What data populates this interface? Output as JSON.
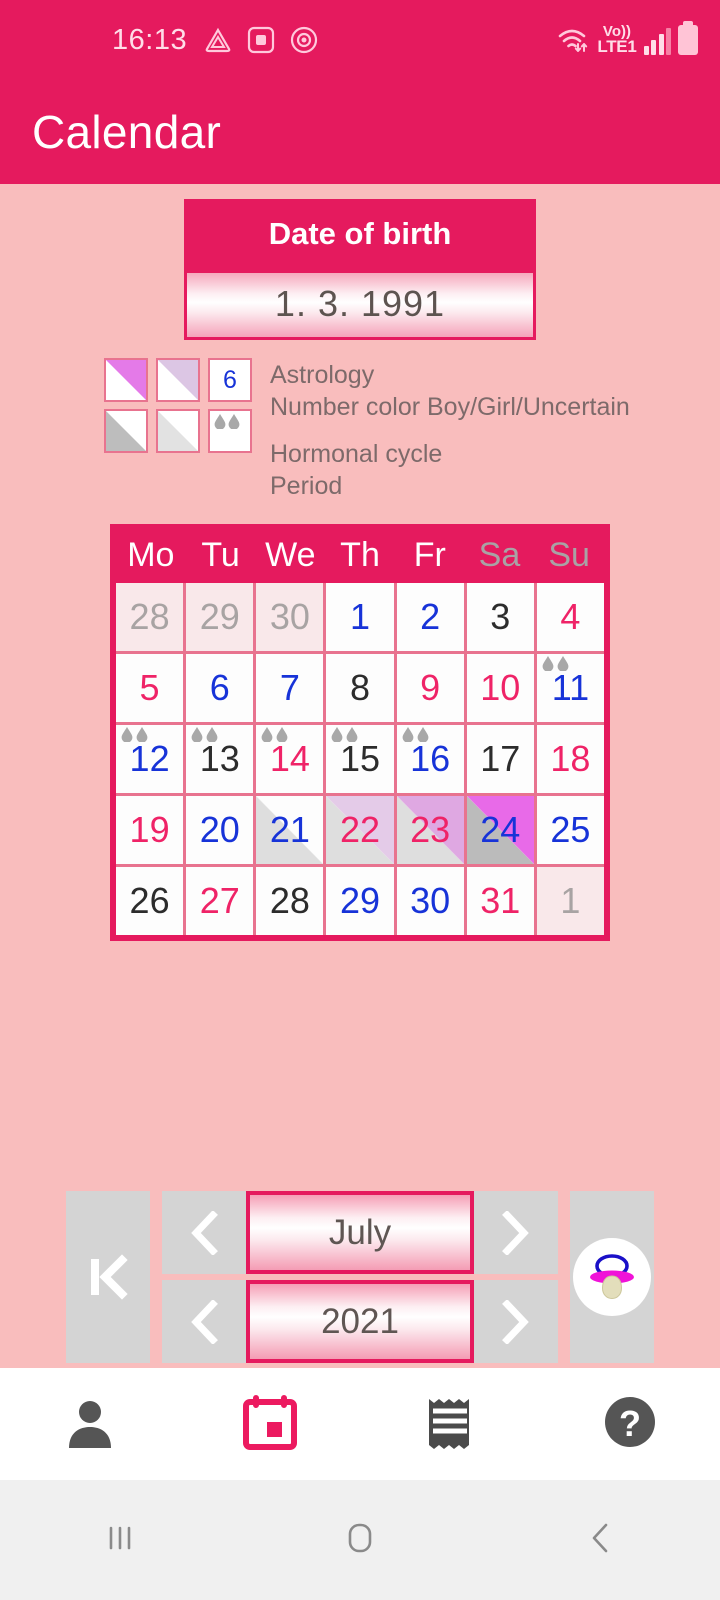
{
  "status_bar": {
    "time": "16:13",
    "network_label_top": "Vo))",
    "network_label_bottom": "LTE1",
    "icons": [
      "triangle-app-icon",
      "screenshot-icon",
      "record-icon",
      "wifi-icon",
      "signal-icon",
      "battery-icon"
    ]
  },
  "header": {
    "title": "Calendar"
  },
  "dob": {
    "label": "Date of birth",
    "value": "1. 3. 1991"
  },
  "legend": {
    "astrology_title": "Astrology",
    "astrology_sub": "Number color Boy/Girl/Uncertain",
    "hormonal_title": "Hormonal cycle",
    "period_title": "Period",
    "sample_number": "6"
  },
  "calendar": {
    "weekdays": [
      "Mo",
      "Tu",
      "We",
      "Th",
      "Fr",
      "Sa",
      "Su"
    ],
    "weekend_index": [
      5,
      6
    ],
    "month": "July",
    "year": "2021",
    "weeks": [
      [
        {
          "d": "28",
          "color": "gray",
          "outside": true
        },
        {
          "d": "29",
          "color": "gray",
          "outside": true
        },
        {
          "d": "30",
          "color": "gray",
          "outside": true
        },
        {
          "d": "1",
          "color": "blue"
        },
        {
          "d": "2",
          "color": "blue"
        },
        {
          "d": "3",
          "color": "black"
        },
        {
          "d": "4",
          "color": "pink"
        }
      ],
      [
        {
          "d": "5",
          "color": "pink"
        },
        {
          "d": "6",
          "color": "blue"
        },
        {
          "d": "7",
          "color": "blue"
        },
        {
          "d": "8",
          "color": "black"
        },
        {
          "d": "9",
          "color": "pink"
        },
        {
          "d": "10",
          "color": "pink"
        },
        {
          "d": "11",
          "color": "blue",
          "period": true
        }
      ],
      [
        {
          "d": "12",
          "color": "blue",
          "period": true
        },
        {
          "d": "13",
          "color": "black",
          "period": true
        },
        {
          "d": "14",
          "color": "pink",
          "period": true
        },
        {
          "d": "15",
          "color": "black",
          "period": true
        },
        {
          "d": "16",
          "color": "blue",
          "period": true
        },
        {
          "d": "17",
          "color": "black"
        },
        {
          "d": "18",
          "color": "pink"
        }
      ],
      [
        {
          "d": "19",
          "color": "pink"
        },
        {
          "d": "20",
          "color": "blue"
        },
        {
          "d": "21",
          "color": "blue",
          "hormonal": "weak",
          "astro": "none"
        },
        {
          "d": "22",
          "color": "pink",
          "hormonal": "weak",
          "astro": "weak"
        },
        {
          "d": "23",
          "color": "pink",
          "hormonal": "weak",
          "astro": "mid"
        },
        {
          "d": "24",
          "color": "blue",
          "hormonal": "strong",
          "astro": "strong"
        },
        {
          "d": "25",
          "color": "blue"
        }
      ],
      [
        {
          "d": "26",
          "color": "black"
        },
        {
          "d": "27",
          "color": "pink"
        },
        {
          "d": "28",
          "color": "black"
        },
        {
          "d": "29",
          "color": "blue"
        },
        {
          "d": "30",
          "color": "blue"
        },
        {
          "d": "31",
          "color": "pink"
        },
        {
          "d": "1",
          "color": "gray",
          "outside": true
        }
      ]
    ]
  },
  "nav_controls": {
    "first_label": "go-to-first",
    "prev_month": "‹",
    "next_month": "›",
    "prev_year": "‹",
    "next_year": "›",
    "baby_label": "pacifier"
  },
  "tabbar": {
    "items": [
      {
        "name": "profile",
        "icon": "person-icon",
        "active": false
      },
      {
        "name": "calendar",
        "icon": "calendar-icon",
        "active": true
      },
      {
        "name": "list",
        "icon": "receipt-icon",
        "active": false
      },
      {
        "name": "help",
        "icon": "question-mark-icon",
        "active": false
      }
    ]
  },
  "android_nav": {
    "recents": "recents-icon",
    "home": "home-icon",
    "back": "back-icon"
  },
  "colors": {
    "accent": "#e51a5e",
    "background": "#f9bdbd",
    "blue": "#1733d8",
    "pink": "#ef2367",
    "black": "#2c2c2c",
    "gray": "#a8a3a3",
    "astrology": "#e86ae8",
    "hormonal": "#bbbbbb"
  }
}
